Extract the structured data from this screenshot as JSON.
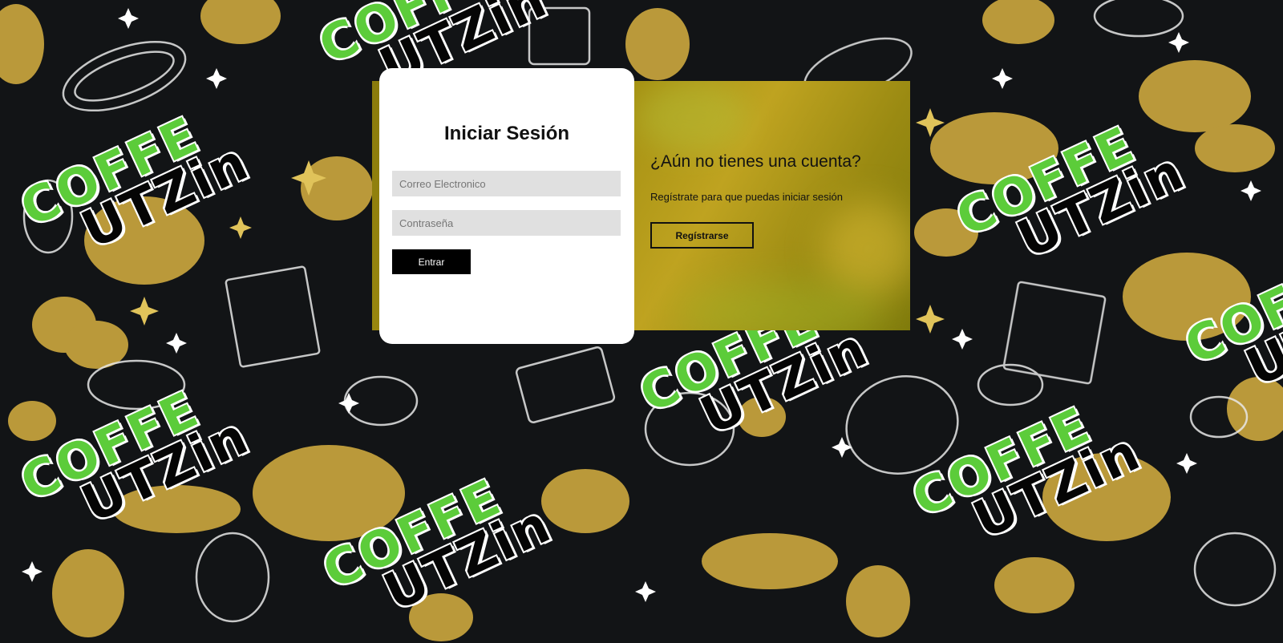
{
  "login": {
    "title": "Iniciar Sesión",
    "email_placeholder": "Correo Electronico",
    "password_placeholder": "Contraseña",
    "submit_label": "Entrar"
  },
  "register": {
    "title": "¿Aún no tienes una cuenta?",
    "text": "Regístrate para que puedas iniciar sesión",
    "button_label": "Regístrarse"
  },
  "background": {
    "logo_line1": "COFFE",
    "logo_line2": "UTZin"
  },
  "colors": {
    "background": "#121416",
    "logo_green": "#5ccc3a",
    "food_gold": "#c9a53e",
    "panel_olive": "#a08d10"
  }
}
